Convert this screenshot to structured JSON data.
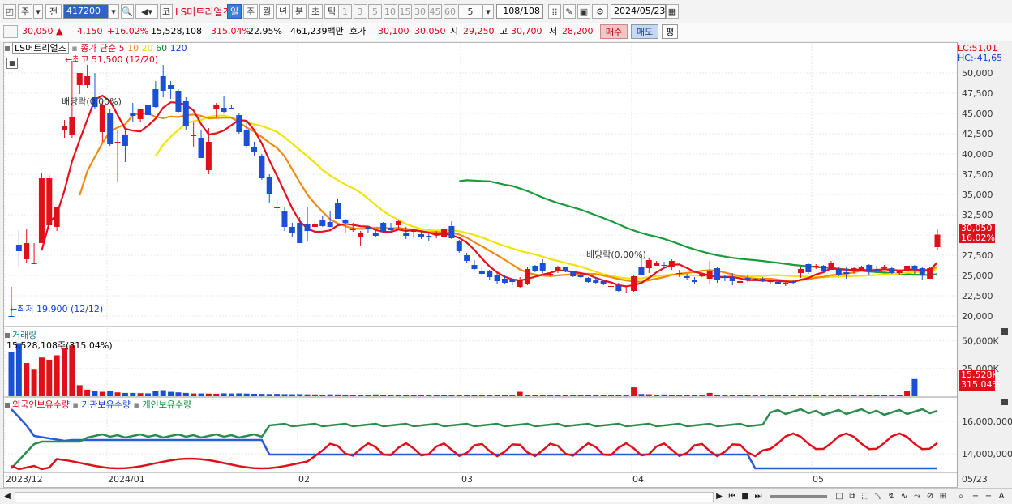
{
  "toolbar": {
    "period_type": "주",
    "prev_label": "전",
    "stock_code": "417200",
    "stock_name": "LS머트리얼즈",
    "market_label": "코",
    "periods": [
      "일",
      "주",
      "월",
      "년",
      "분",
      "초",
      "틱"
    ],
    "active_period": "일",
    "intervals": [
      "1",
      "3",
      "5",
      "10",
      "15",
      "30",
      "45",
      "60"
    ],
    "interval_value": "5",
    "count_value": "108",
    "count_total": "/108",
    "date_value": "2024/05/23"
  },
  "quote": {
    "price": "30,050",
    "direction_symbol": "▲",
    "change": "4,150",
    "change_pct": "+16.02%",
    "volume": "15,528,108",
    "volume_ratio": "315.04%",
    "turnover": "22.95%",
    "trade_amount": "461,239백만",
    "ask_label": "호가",
    "ask1": "30,100",
    "bid1": "30,050",
    "open_label": "시",
    "open": "29,250",
    "high_label": "고",
    "high": "30,700",
    "low_label": "저",
    "low": "28,200",
    "buy_label": "매수",
    "sell_label": "매도",
    "avg_label": "평"
  },
  "price_pane": {
    "title": "LS머트리얼즈",
    "ma_label": "종가 단순",
    "ma_periods": [
      "5",
      "10",
      "20",
      "60",
      "120"
    ],
    "ma_colors": [
      "#e8101c",
      "#ef8a12",
      "#f2e20a",
      "#1a9b3c",
      "#1f6fe0"
    ],
    "high_note": "최고 51,500 (12/20)",
    "low_note": "최저 19,900 (12/12)",
    "dividend_note_1": "배당락(0,00%)",
    "dividend_note_2": "배당락(0,00%)",
    "lc": "LC:51,01",
    "hc": "HC:-41,65",
    "y_ticks": [
      "50,000",
      "47,500",
      "45,000",
      "42,500",
      "40,000",
      "37,500",
      "35,000",
      "32,500",
      "30,000",
      "27,500",
      "25,000",
      "22,500",
      "20,000"
    ],
    "current_price_tag": "30,050",
    "current_pct_tag": "16.02%"
  },
  "volume_pane": {
    "title": "거래량",
    "value_note": "15,528,108주(315.04%)",
    "y_ticks": [
      "50,000K",
      "25,000K"
    ],
    "current_tag": "15,528K",
    "current_pct": "315.04%"
  },
  "holding_pane": {
    "legend": [
      "외국인보유수량",
      "기관보유수량",
      "개인보유수량"
    ],
    "colors": [
      "#e0101a",
      "#2a5bd7",
      "#2e8b4e"
    ],
    "y_ticks": [
      "16,000,000",
      "14,000,000"
    ]
  },
  "x_axis": {
    "labels": [
      "2023/12",
      "2024/01",
      "02",
      "03",
      "04",
      "05"
    ],
    "current_label": "05/23"
  },
  "chart_data": {
    "type": "candlestick",
    "ylim": [
      19000,
      52000
    ],
    "y_ticks": [
      20000,
      22500,
      25000,
      27500,
      30000,
      32500,
      35000,
      37500,
      40000,
      42500,
      45000,
      47500,
      50000
    ],
    "ohlc": [
      [
        20000,
        23600,
        19900,
        19900
      ],
      [
        28800,
        30600,
        26000,
        28000
      ],
      [
        27000,
        30700,
        26500,
        29000
      ],
      [
        26500,
        29000,
        26500,
        26500
      ],
      [
        29000,
        37700,
        29000,
        37000
      ],
      [
        31200,
        37400,
        31200,
        37000
      ],
      [
        31000,
        33500,
        30500,
        33400
      ],
      [
        43000,
        44200,
        42000,
        43500
      ],
      [
        42400,
        51500,
        42000,
        44600
      ],
      [
        48500,
        50000,
        47400,
        50000
      ],
      [
        48500,
        51000,
        48200,
        49600
      ],
      [
        47000,
        50000,
        45600,
        45800
      ],
      [
        42700,
        46500,
        41500,
        46000
      ],
      [
        45000,
        45500,
        41000,
        41200
      ],
      [
        41400,
        43000,
        36500,
        41500
      ],
      [
        42400,
        43000,
        39000,
        41000
      ],
      [
        45000,
        46300,
        44000,
        44700
      ],
      [
        44300,
        45500,
        44000,
        45500
      ],
      [
        46000,
        46300,
        44400,
        44800
      ],
      [
        48000,
        49000,
        45700,
        45800
      ],
      [
        49600,
        51000,
        47000,
        47800
      ],
      [
        48500,
        49000,
        46800,
        48000
      ],
      [
        47800,
        48000,
        45000,
        45200
      ],
      [
        46500,
        47000,
        43000,
        43500
      ],
      [
        42200,
        44000,
        40800,
        42300
      ],
      [
        42000,
        43000,
        39500,
        39500
      ],
      [
        38000,
        43200,
        37500,
        41500
      ],
      [
        45500,
        46300,
        44500,
        46000
      ],
      [
        45700,
        47200,
        45000,
        45200
      ],
      [
        45700,
        46100,
        45500,
        45600
      ],
      [
        44800,
        45000,
        42500,
        42700
      ],
      [
        43000,
        44000,
        40700,
        41000
      ],
      [
        40800,
        41500,
        39800,
        40200
      ],
      [
        39800,
        40000,
        36800,
        37000
      ],
      [
        37200,
        37500,
        34000,
        35000
      ],
      [
        33500,
        34500,
        33000,
        33300
      ],
      [
        33000,
        33500,
        30500,
        31000
      ],
      [
        31000,
        31500,
        29800,
        30200
      ],
      [
        31500,
        32200,
        29000,
        29000
      ],
      [
        31300,
        33500,
        29200,
        30500
      ],
      [
        31000,
        32000,
        30300,
        31300
      ],
      [
        31900,
        32400,
        31000,
        31100
      ],
      [
        31600,
        33000,
        31000,
        31000
      ],
      [
        34000,
        34500,
        32000,
        32000
      ],
      [
        31800,
        32000,
        30200,
        31500
      ],
      [
        30600,
        31500,
        30400,
        30700
      ],
      [
        29800,
        30500,
        28700,
        30200
      ],
      [
        31000,
        31100,
        30200,
        30800
      ],
      [
        30300,
        30600,
        29800,
        29900
      ],
      [
        31500,
        31600,
        30300,
        30400
      ],
      [
        30900,
        31500,
        30200,
        30600
      ],
      [
        31200,
        31800,
        30700,
        31700
      ],
      [
        30300,
        31000,
        29500,
        29900
      ],
      [
        30500,
        30700,
        29700,
        30500
      ],
      [
        30100,
        30500,
        29500,
        29700
      ],
      [
        29900,
        30200,
        29300,
        29700
      ],
      [
        30100,
        30500,
        29600,
        30200
      ],
      [
        29800,
        31300,
        29700,
        30700
      ],
      [
        31100,
        31700,
        29500,
        29600
      ],
      [
        29300,
        29400,
        27800,
        28000
      ],
      [
        27500,
        27800,
        26500,
        26800
      ],
      [
        26300,
        26900,
        25700,
        25800
      ],
      [
        25500,
        26000,
        24900,
        25200
      ],
      [
        25600,
        25700,
        24500,
        24800
      ],
      [
        25000,
        25300,
        24000,
        24300
      ],
      [
        24600,
        25000,
        23900,
        24100
      ],
      [
        24400,
        24600,
        23800,
        24200
      ],
      [
        23600,
        24800,
        23500,
        24500
      ],
      [
        23900,
        26000,
        23800,
        25800
      ],
      [
        26200,
        26300,
        25400,
        25600
      ],
      [
        26500,
        27000,
        25300,
        25500
      ],
      [
        25000,
        25400,
        24900,
        25200
      ],
      [
        25500,
        26200,
        25300,
        26100
      ],
      [
        26000,
        26100,
        25400,
        25500
      ],
      [
        25500,
        25600,
        24800,
        24900
      ],
      [
        25000,
        25300,
        24700,
        24800
      ],
      [
        24700,
        24800,
        24100,
        24200
      ],
      [
        24500,
        24700,
        24000,
        24100
      ],
      [
        24300,
        24500,
        23800,
        23900
      ],
      [
        23600,
        24200,
        23400,
        23700
      ],
      [
        23800,
        24100,
        23000,
        23100
      ],
      [
        23400,
        23700,
        22900,
        23500
      ],
      [
        23100,
        25000,
        23000,
        24900
      ],
      [
        26000,
        27300,
        25000,
        25100
      ],
      [
        25900,
        27200,
        25300,
        26900
      ],
      [
        26200,
        26800,
        26200,
        26600
      ],
      [
        26300,
        26700,
        26000,
        26200
      ],
      [
        26000,
        27000,
        25700,
        26800
      ],
      [
        25300,
        25700,
        24800,
        25300
      ],
      [
        24900,
        25200,
        24500,
        24700
      ],
      [
        24500,
        24800,
        24000,
        24200
      ],
      [
        24900,
        25300,
        24800,
        25200
      ],
      [
        24600,
        26800,
        24000,
        25500
      ],
      [
        25900,
        26100,
        24100,
        24400
      ],
      [
        24900,
        25000,
        24300,
        24700
      ],
      [
        24800,
        25300,
        23800,
        24300
      ],
      [
        24100,
        24500,
        23900,
        24300
      ],
      [
        24700,
        25100,
        24200,
        24400
      ],
      [
        24600,
        24700,
        24300,
        24500
      ],
      [
        24600,
        24800,
        24200,
        24300
      ],
      [
        24200,
        24500,
        24000,
        24400
      ],
      [
        24200,
        24600,
        23800,
        24000
      ],
      [
        23900,
        24200,
        23700,
        24100
      ],
      [
        24300,
        24500,
        23900,
        24100
      ],
      [
        25300,
        26000,
        24700,
        25800
      ],
      [
        26400,
        26500,
        25200,
        25400
      ],
      [
        26000,
        26400,
        25800,
        26200
      ],
      [
        26200,
        26300,
        25500,
        25500
      ],
      [
        25700,
        26800,
        25700,
        26600
      ],
      [
        25700,
        26000,
        24900,
        25100
      ],
      [
        25400,
        26000,
        24600,
        25200
      ],
      [
        25600,
        26000,
        25200,
        25900
      ],
      [
        25600,
        26200,
        25500,
        26100
      ],
      [
        26300,
        26400,
        25100,
        25500
      ],
      [
        25800,
        26200,
        25300,
        25500
      ],
      [
        26000,
        26300,
        25700,
        26000
      ],
      [
        25900,
        26100,
        25200,
        25300
      ],
      [
        25300,
        25700,
        25000,
        25500
      ],
      [
        25700,
        26400,
        25300,
        26200
      ],
      [
        26200,
        26300,
        25200,
        25800
      ],
      [
        25900,
        26100,
        24500,
        25100
      ],
      [
        24600,
        26100,
        25100,
        25900
      ],
      [
        28500,
        30700,
        28200,
        30050
      ]
    ],
    "volume": [
      40000,
      48000,
      30000,
      24000,
      35000,
      33000,
      37000,
      44000,
      46000,
      10000,
      6000,
      5000,
      4000,
      4500,
      3500,
      3000,
      3000,
      2800,
      2600,
      5000,
      5500,
      4000,
      3500,
      3000,
      2500,
      2500,
      2400,
      2300,
      2600,
      2500,
      2600,
      2400,
      2200,
      2100,
      2000,
      2100,
      1900,
      1800,
      1900,
      1700,
      1600,
      1500,
      1700,
      1600,
      1500,
      1400,
      1300,
      1400,
      1600,
      1500,
      1300,
      1250,
      1200,
      1200,
      1500,
      1300,
      1200,
      1100,
      1300,
      1100,
      1000,
      1100,
      1050,
      1000,
      1200,
      1000,
      950,
      4000,
      900,
      1000,
      850,
      900,
      800,
      900,
      850,
      900,
      950,
      800,
      850,
      900,
      750,
      700,
      8000,
      2000,
      1800,
      1500,
      1600,
      1400,
      1300,
      1200,
      1100,
      1250,
      3000,
      1150,
      1100,
      1050,
      1000,
      1100,
      950,
      900,
      950,
      1000,
      1200,
      1050,
      1000,
      1100,
      950,
      1050,
      1000,
      1100,
      1200,
      1150,
      1050,
      1000,
      950,
      1100,
      1250,
      1150,
      5000,
      15528
    ],
    "ma_series": [
      "MA5",
      "MA10",
      "MA20",
      "MA60"
    ]
  }
}
